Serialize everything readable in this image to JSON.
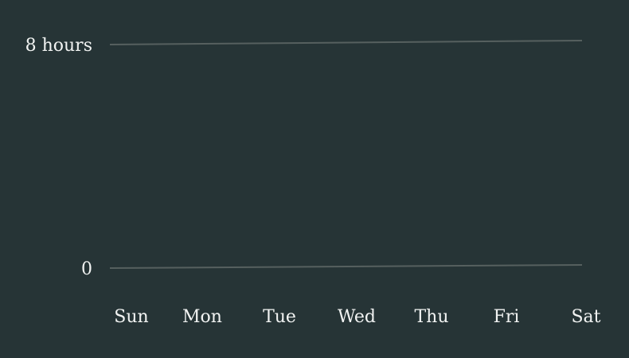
{
  "chart_data": {
    "type": "line",
    "title": "",
    "xlabel": "",
    "ylabel": "",
    "categories": [
      "Sun",
      "Mon",
      "Tue",
      "Wed",
      "Thu",
      "Fri",
      "Sat"
    ],
    "y_ticks": [
      {
        "value": 0,
        "label": "0"
      },
      {
        "value": 8,
        "label": "8 hours"
      }
    ],
    "ylim": [
      0,
      8
    ],
    "grid": true,
    "series": [],
    "colors": {
      "background": "#263436",
      "grid": "#56605f",
      "text": "#f1f3f2"
    }
  }
}
